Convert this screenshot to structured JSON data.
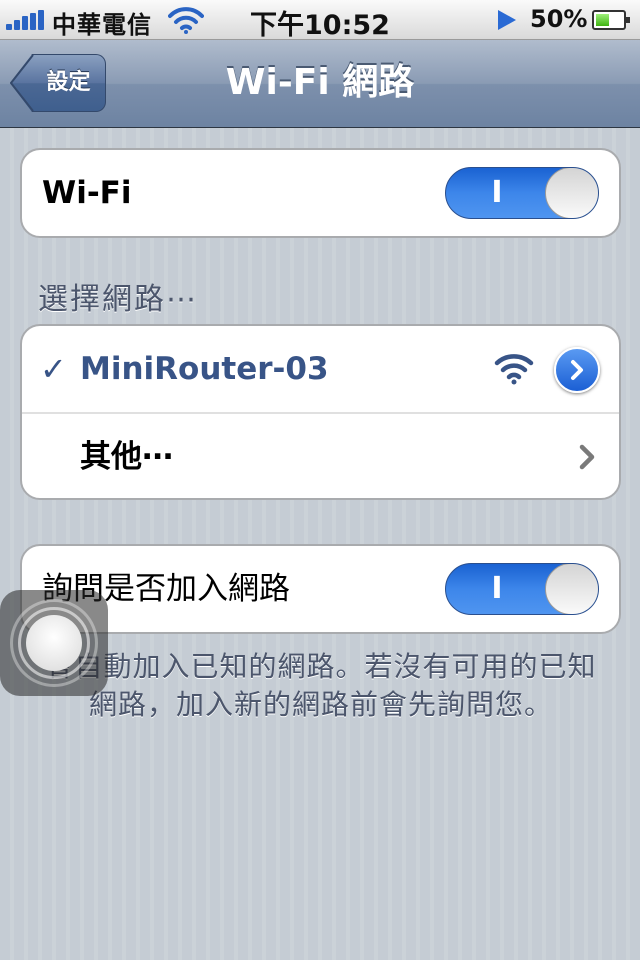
{
  "status_bar": {
    "carrier": "中華電信",
    "time": "下午10:52",
    "battery_percent": "50%",
    "battery_level": 0.5,
    "icons": [
      "signal-bars-icon",
      "wifi-icon",
      "location-icon",
      "battery-icon"
    ]
  },
  "nav": {
    "back_label": "設定",
    "title": "Wi-Fi 網路"
  },
  "wifi_group": {
    "label": "Wi-Fi",
    "toggle_state": "I"
  },
  "networks": {
    "header": "選擇網路⋯",
    "checkmark": "✓",
    "items": [
      {
        "name": "MiniRouter-03",
        "selected": true
      },
      {
        "name": "其他⋯"
      }
    ]
  },
  "ask_group": {
    "label": "詢問是否加入網路",
    "toggle_state": "I",
    "note": "會自動加入已知的網路。若沒有可用的已知網路，加入新的網路前會先詢問您。"
  },
  "colors": {
    "accent_blue": "#385487",
    "toggle_on": "#3d86ea",
    "background": "#c5ccd4"
  }
}
